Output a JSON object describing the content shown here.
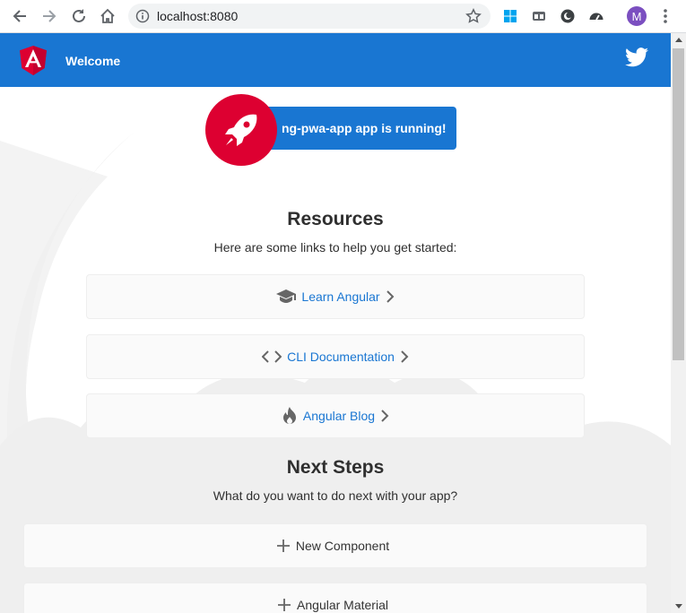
{
  "browser": {
    "url": "localhost:8080",
    "profile_initial": "M"
  },
  "toolbar": {
    "title": "Welcome"
  },
  "running": {
    "text": "ng-pwa-app app is running!"
  },
  "resources": {
    "heading": "Resources",
    "subtitle": "Here are some links to help you get started:",
    "links": [
      {
        "label": "Learn Angular",
        "icon": "graduation-cap-icon"
      },
      {
        "label": "CLI Documentation",
        "icon": "code-brackets-icon"
      },
      {
        "label": "Angular Blog",
        "icon": "flame-icon"
      }
    ]
  },
  "next_steps": {
    "heading": "Next Steps",
    "subtitle": "What do you want to do next with your app?",
    "items": [
      {
        "label": "New Component",
        "icon": "plus-icon"
      },
      {
        "label": "Angular Material",
        "icon": "plus-icon"
      }
    ]
  },
  "colors": {
    "brand_blue": "#1976d2",
    "angular_red": "#dd0031",
    "card_bg": "#fafafa"
  }
}
